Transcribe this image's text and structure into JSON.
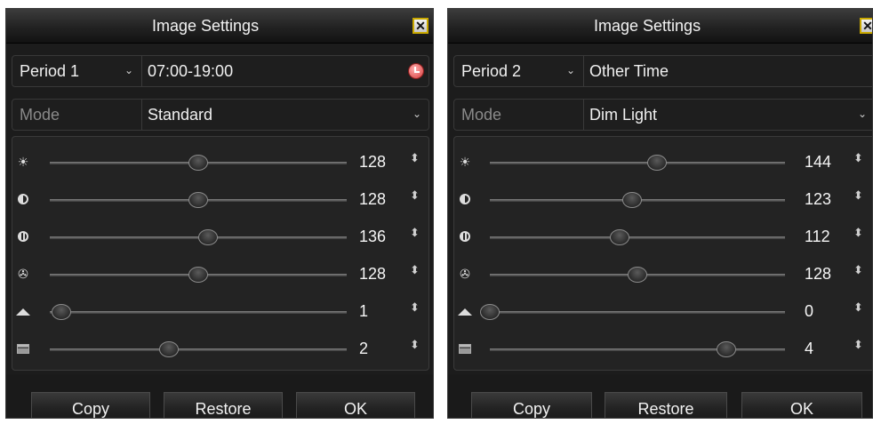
{
  "panels": [
    {
      "title": "Image Settings",
      "close_glyph": "✕",
      "period": {
        "label": "Period 1",
        "time": "07:00-19:00"
      },
      "mode": {
        "label": "Mode",
        "value": "Standard"
      },
      "sliders": [
        {
          "name": "brightness",
          "icon": "brightness-icon",
          "value": "128",
          "level": 0.5
        },
        {
          "name": "contrast",
          "icon": "contrast-icon",
          "value": "128",
          "level": 0.5
        },
        {
          "name": "saturation",
          "icon": "saturation-icon",
          "value": "136",
          "level": 0.533
        },
        {
          "name": "hue",
          "icon": "hue-icon",
          "value": "128",
          "level": 0.5
        },
        {
          "name": "sharpness",
          "icon": "sharpness-icon",
          "value": "1",
          "level": 0.04
        },
        {
          "name": "denoising",
          "icon": "denoising-icon",
          "value": "2",
          "level": 0.4
        }
      ],
      "buttons": {
        "copy": "Copy",
        "restore": "Restore",
        "ok": "OK"
      }
    },
    {
      "title": "Image Settings",
      "close_glyph": "✕",
      "period": {
        "label": "Period 2",
        "time": "Other Time"
      },
      "mode": {
        "label": "Mode",
        "value": "Dim Light"
      },
      "sliders": [
        {
          "name": "brightness",
          "icon": "brightness-icon",
          "value": "144",
          "level": 0.565
        },
        {
          "name": "contrast",
          "icon": "contrast-icon",
          "value": "123",
          "level": 0.482
        },
        {
          "name": "saturation",
          "icon": "saturation-icon",
          "value": "112",
          "level": 0.439
        },
        {
          "name": "hue",
          "icon": "hue-icon",
          "value": "128",
          "level": 0.5
        },
        {
          "name": "sharpness",
          "icon": "sharpness-icon",
          "value": "0",
          "level": 0.0
        },
        {
          "name": "denoising",
          "icon": "denoising-icon",
          "value": "4",
          "level": 0.8
        }
      ],
      "buttons": {
        "copy": "Copy",
        "restore": "Restore",
        "ok": "OK"
      }
    }
  ],
  "glyphs": {
    "chevron": "⌄",
    "spinner": "⬍",
    "sun": "☀"
  }
}
